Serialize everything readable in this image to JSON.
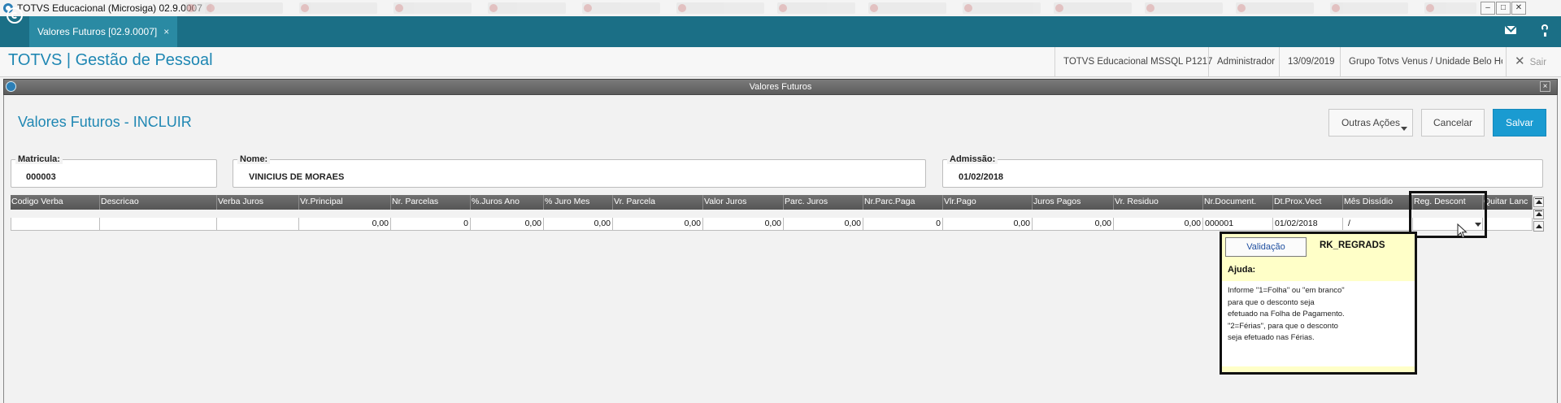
{
  "os": {
    "title": "TOTVS Educacional (Microsiga) 02.9.0007",
    "buttons": [
      "–",
      "□",
      "✕"
    ]
  },
  "tabbar": {
    "tab_label": "Valores Futuros [02.9.0007]",
    "tab_close": "×"
  },
  "header": {
    "product": "TOTVS | Gestão de Pessoal",
    "environment": "TOTVS Educacional MSSQL P1217",
    "user": "Administrador",
    "date": "13/09/2019",
    "company": "Grupo Totvs Venus / Unidade Belo Ho",
    "logout_label": "Sair",
    "logout_icon": "✕"
  },
  "dialog": {
    "title": "Valores Futuros",
    "close": "×",
    "form_title": "Valores Futuros - INCLUIR",
    "buttons": {
      "outras": "Outras Ações",
      "cancelar": "Cancelar",
      "salvar": "Salvar"
    },
    "fields": {
      "matricula": {
        "label": "Matricula:",
        "value": "000003"
      },
      "nome": {
        "label": "Nome:",
        "value": "VINICIUS DE MORAES"
      },
      "admissao": {
        "label": "Admissão:",
        "value": "01/02/2018"
      }
    }
  },
  "grid": {
    "columns": [
      "Codigo Verba",
      "Descricao",
      "Verba Juros",
      "Vr.Principal",
      "Nr. Parcelas",
      "%.Juros Ano",
      "% Juro Mes",
      "Vr. Parcela",
      "Valor Juros",
      "Parc. Juros",
      "Nr.Parc.Paga",
      "Vlr.Pago",
      "Juros Pagos",
      "Vr. Residuo",
      "Nr.Document.",
      "Dt.Prox.Vect",
      "Mês Dissídio",
      "Reg. Descont",
      "Quitar Lanc"
    ],
    "row": [
      "",
      "",
      "",
      "0,00",
      "0",
      "0,00",
      "0,00",
      "0,00",
      "0,00",
      "0,00",
      "0",
      "0,00",
      "0,00",
      "0,00",
      "000001",
      "01/02/2018",
      "/",
      "",
      ""
    ]
  },
  "help": {
    "validation_button": "Validação",
    "field_name": "RK_REGRADS",
    "title": "Ajuda:",
    "lines": [
      "Informe \"1=Folha\" ou \"em branco\"",
      "para que o desconto seja",
      "efetuado na Folha de Pagamento.",
      "\"2=Férias\", para que o desconto",
      "seja efetuado nas Férias."
    ]
  },
  "colors": {
    "teal": "#1b6f86",
    "accent_blue": "#1f87b3",
    "save_button": "#1a9bd1",
    "help_bg": "#ffffc8"
  }
}
